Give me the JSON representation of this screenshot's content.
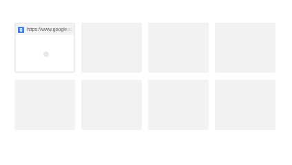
{
  "most_visited": {
    "tiles": [
      {
        "url": "https://www.google.co",
        "favicon_letter": "g",
        "favicon_color": "#4a7fd8",
        "state": "loading"
      },
      {
        "state": "empty"
      },
      {
        "state": "empty"
      },
      {
        "state": "empty"
      },
      {
        "state": "empty"
      },
      {
        "state": "empty"
      },
      {
        "state": "empty"
      },
      {
        "state": "empty"
      }
    ]
  }
}
